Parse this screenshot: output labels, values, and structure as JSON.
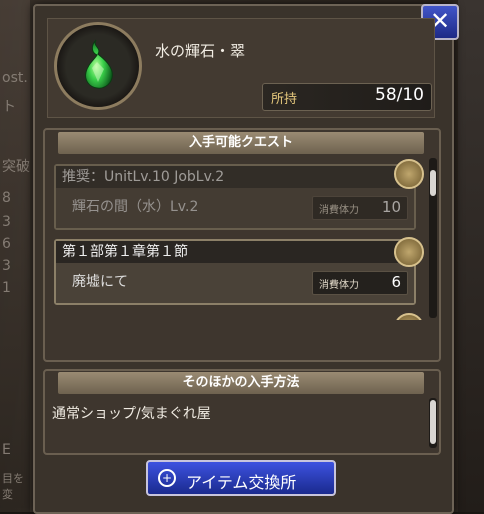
{
  "background": {
    "left_texts": [
      "ost.",
      "ト",
      "突破",
      "8",
      "3",
      "6",
      "3",
      "1",
      "E",
      "目を変"
    ]
  },
  "dialog": {
    "close_label": "✕",
    "item": {
      "name": "水の輝石・翠",
      "owned_label": "所持",
      "owned_value": "58/10",
      "icon": "green-gem-icon"
    },
    "quests_section": {
      "title": "入手可能クエスト",
      "quests": [
        {
          "title": "推奨：UnitLv.10 JobLv.2",
          "stage": "輝石の間（水）Lv.2",
          "stamina_label": "消費体力",
          "stamina_value": "10",
          "locked": true
        },
        {
          "title": "第１部第１章第１節",
          "stage": "廃墟にて",
          "stamina_label": "消費体力",
          "stamina_value": "6",
          "locked": false
        }
      ]
    },
    "other_section": {
      "title": "そのほかの入手方法",
      "text": "通常ショップ/気まぐれ屋"
    },
    "exchange_button": {
      "label": "アイテム交換所"
    }
  },
  "colors": {
    "accent_blue": "#2f44c8",
    "gold_text": "#e6c97d",
    "gem_green": "#3ad04a"
  }
}
